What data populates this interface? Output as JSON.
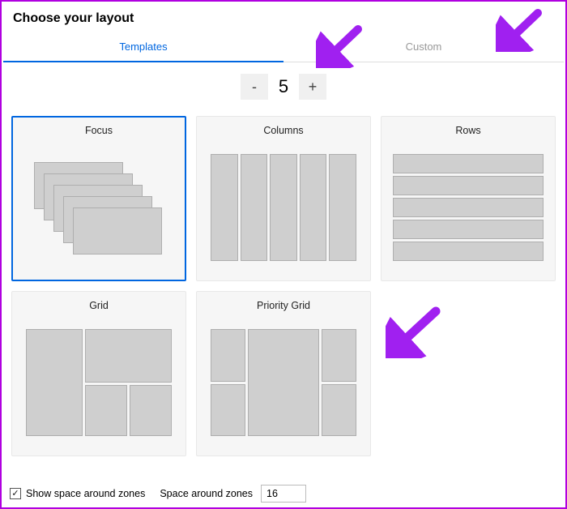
{
  "title": "Choose your layout",
  "tabs": {
    "templates": "Templates",
    "custom": "Custom"
  },
  "stepper": {
    "minus": "-",
    "value": "5",
    "plus": "+"
  },
  "cards": {
    "focus": "Focus",
    "columns": "Columns",
    "rows": "Rows",
    "grid": "Grid",
    "priority": "Priority Grid"
  },
  "footer": {
    "show_space_label": "Show space around zones",
    "space_label": "Space around zones",
    "space_value": "16",
    "checked": "✓"
  },
  "colors": {
    "accent": "#0066e0",
    "annotation": "#a020f0"
  }
}
